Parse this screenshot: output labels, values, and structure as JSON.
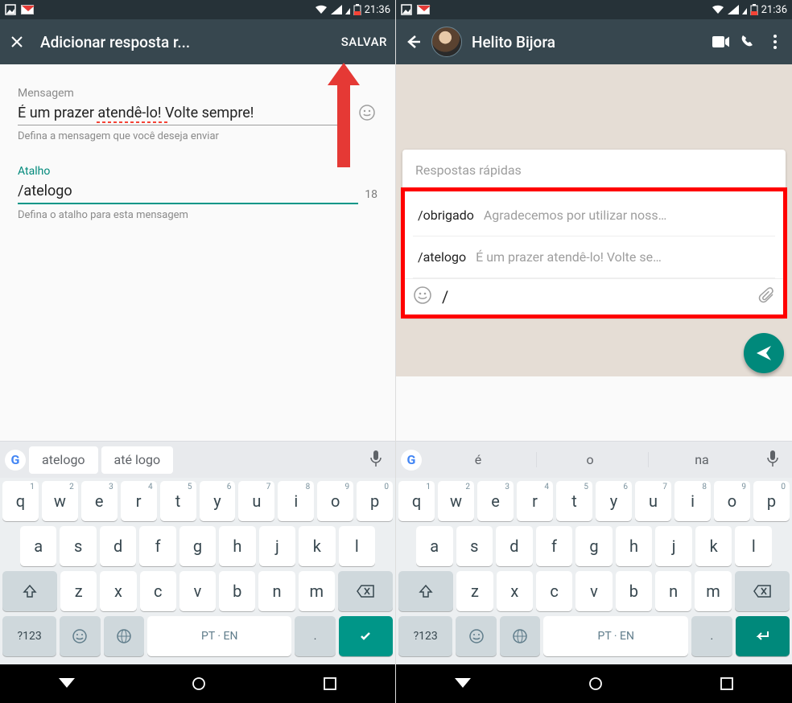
{
  "status": {
    "time": "21:36"
  },
  "left": {
    "title": "Adicionar resposta r...",
    "save": "SALVAR",
    "message_label": "Mensagem",
    "message_value": "É um prazer atendê-lo! Volte sempre!",
    "message_hint": "Defina a mensagem que você deseja enviar",
    "shortcut_label": "Atalho",
    "shortcut_value": "/atelogo",
    "shortcut_counter": "18",
    "shortcut_hint": "Defina o atalho para esta mensagem"
  },
  "right": {
    "contact": "Helito Bijora",
    "quick_title": "Respostas rápidas",
    "items": [
      {
        "cmd": "/obrigado",
        "text": "Agradecemos por utilizar noss…"
      },
      {
        "cmd": "/atelogo",
        "text": "É um prazer atendê-lo! Volte se…"
      }
    ],
    "typed": "/"
  },
  "kb_left": {
    "sug1": "atelogo",
    "sug2": "até logo",
    "space": "PT · EN",
    "numKey": "?123",
    "period": "."
  },
  "kb_right": {
    "s1": "é",
    "s2": "o",
    "s3": "na",
    "space": "PT · EN",
    "numKey": "?123",
    "period": "."
  },
  "keys": {
    "r1": [
      [
        "q",
        "1"
      ],
      [
        "w",
        "2"
      ],
      [
        "e",
        "3"
      ],
      [
        "r",
        "4"
      ],
      [
        "t",
        "5"
      ],
      [
        "y",
        "6"
      ],
      [
        "u",
        "7"
      ],
      [
        "i",
        "8"
      ],
      [
        "o",
        "9"
      ],
      [
        "p",
        "0"
      ]
    ],
    "r2": [
      "a",
      "s",
      "d",
      "f",
      "g",
      "h",
      "j",
      "k",
      "l"
    ],
    "r3": [
      "z",
      "x",
      "c",
      "v",
      "b",
      "n",
      "m"
    ]
  }
}
